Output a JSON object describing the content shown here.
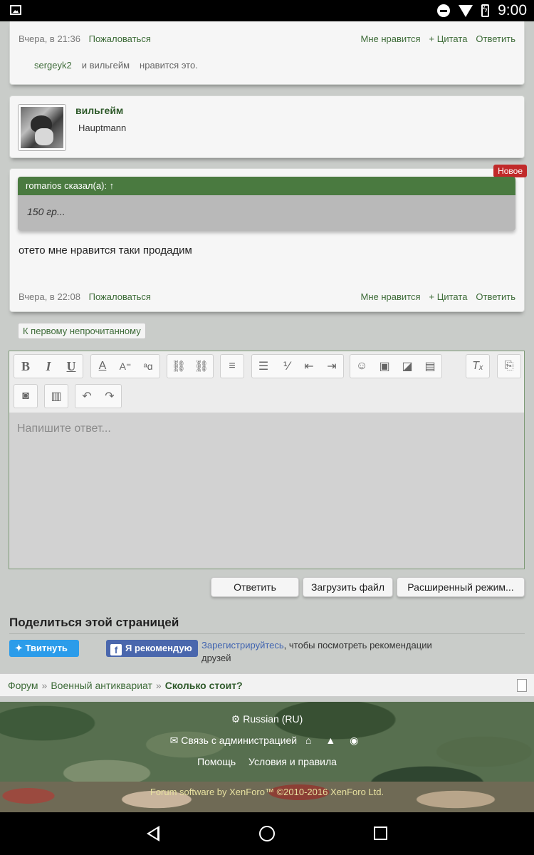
{
  "statusbar": {
    "time": "9:00"
  },
  "post1": {
    "date": "Вчера, в 21:36",
    "report": "Пожаловаться",
    "like": "Мне нравится",
    "quote": "+ Цитата",
    "reply": "Ответить",
    "likes": {
      "user1": "sergeyk2",
      "conj": "и вильгейм",
      "suffix": "нравится это."
    }
  },
  "profile": {
    "name": "вильгейм",
    "title": "Hauptmann"
  },
  "post2": {
    "badge": "Новое",
    "quote_header": "romarios сказал(а): ↑",
    "quote_text": "150 гр...",
    "text": "отето мне нравится таки продадим",
    "date": "Вчера, в 22:08",
    "report": "Пожаловаться",
    "like": "Мне нравится",
    "quote": "+ Цитата",
    "reply": "Ответить"
  },
  "unread_button": "К первому непрочитанному",
  "editor": {
    "placeholder": "Напишите ответ...",
    "toolbar_icons": [
      "bold-icon",
      "italic-icon",
      "underline-icon",
      "text-color-icon",
      "font-size-icon",
      "font-family-icon",
      "link-icon",
      "unlink-icon",
      "align-icon",
      "bullet-list-icon",
      "numbered-list-icon",
      "outdent-icon",
      "indent-icon",
      "smilie-icon",
      "image-icon",
      "media-icon",
      "insert-icon",
      "remove-format-icon",
      "bbcode-icon",
      "camera-icon",
      "save-icon",
      "undo-icon",
      "redo-icon"
    ]
  },
  "buttons": {
    "reply": "Ответить",
    "upload": "Загрузить файл",
    "advanced": "Расширенный режим..."
  },
  "share": {
    "title": "Поделиться этой страницей",
    "tweet": "Твитнуть",
    "fb": "Я рекомендую",
    "register": "Зарегистрируйтесь",
    "note": ", чтобы посмотреть рекомендации друзей"
  },
  "breadcrumb": {
    "items": [
      "Форум",
      "Военный антиквариат"
    ],
    "current": "Сколько стоит?"
  },
  "footer": {
    "language": "Russian (RU)",
    "contact": "Связь с администрацией",
    "help": "Помощь",
    "terms": "Условия и правила",
    "copyright": "Forum software by XenForo™ ©2010-2016 XenForo Ltd."
  }
}
